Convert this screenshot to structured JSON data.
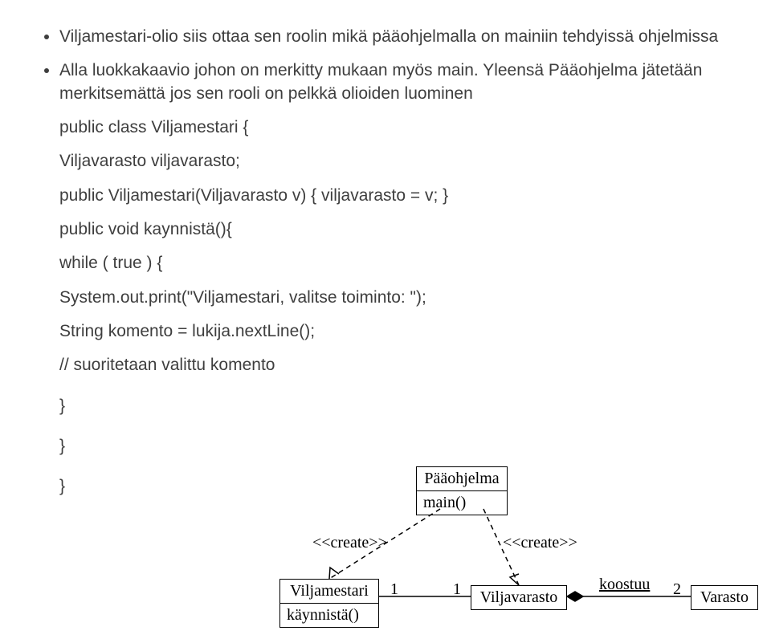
{
  "bullets": {
    "b1": "Viljamestari-olio siis ottaa sen roolin mikä pääohjelmalla on mainiin tehdyissä ohjelmissa",
    "b2": "Alla luokkakaavio johon on merkitty mukaan myös main. Yleensä Pääohjelma jätetään merkitsemättä jos sen rooli  on pelkkä olioiden luominen"
  },
  "code": {
    "l1": "public class Viljamestari {",
    "l2": "Viljavarasto viljavarasto;",
    "l3": "public Viljamestari(Viljavarasto v) { viljavarasto = v; }",
    "l4": "public void kaynnistä(){",
    "l5": "while ( true ) {",
    "l6": "System.out.print(\"Viljamestari, valitse toiminto: \");",
    "l7": "String komento = lukija.nextLine();",
    "l8": "// suoritetaan valittu komento",
    "l9": "}",
    "l10": "}",
    "l11": "}"
  },
  "diagram": {
    "paa_name": "Pääohjelma",
    "paa_method": "main()",
    "create1": "<<create>>",
    "create2": "<<create>>",
    "vm_name": "Viljamestari",
    "vm_method": "käynnistä()",
    "m_vm_vv_left": "1",
    "m_vm_vv_right": "1",
    "vv_name": "Viljavarasto",
    "koostuu": "koostuu",
    "m_vv_var": "2",
    "var_name": "Varasto"
  }
}
